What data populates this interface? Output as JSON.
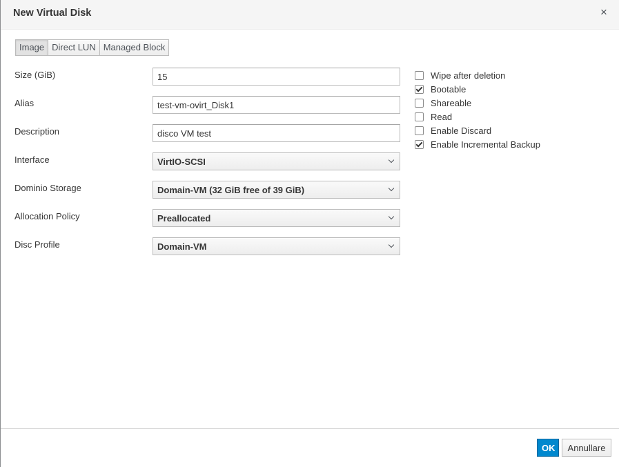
{
  "dialog": {
    "title": "New Virtual Disk",
    "close_label": "×"
  },
  "tabs": [
    {
      "label": "Image",
      "active": true
    },
    {
      "label": "Direct LUN",
      "active": false
    },
    {
      "label": "Managed Block",
      "active": false
    }
  ],
  "form": {
    "size": {
      "label": "Size (GiB)",
      "value": "15"
    },
    "alias": {
      "label": "Alias",
      "value": "test-vm-ovirt_Disk1"
    },
    "description": {
      "label": "Description",
      "value": "disco VM test"
    },
    "interface": {
      "label": "Interface",
      "value": "VirtIO-SCSI"
    },
    "storage_domain": {
      "label": "Dominio Storage",
      "value": "Domain-VM (32 GiB free of 39 GiB)"
    },
    "allocation_policy": {
      "label": "Allocation Policy",
      "value": "Preallocated"
    },
    "disk_profile": {
      "label": "Disc Profile",
      "value": "Domain-VM"
    }
  },
  "options": [
    {
      "label": "Wipe after deletion",
      "checked": false
    },
    {
      "label": "Bootable",
      "checked": true
    },
    {
      "label": "Shareable",
      "checked": false
    },
    {
      "label": "Read",
      "checked": false
    },
    {
      "label": "Enable Discard",
      "checked": false
    },
    {
      "label": "Enable Incremental Backup",
      "checked": true
    }
  ],
  "footer": {
    "ok_label": "OK",
    "cancel_label": "Annullare"
  },
  "colors": {
    "primary": "#0088ce",
    "header_bg": "#f5f5f5"
  }
}
